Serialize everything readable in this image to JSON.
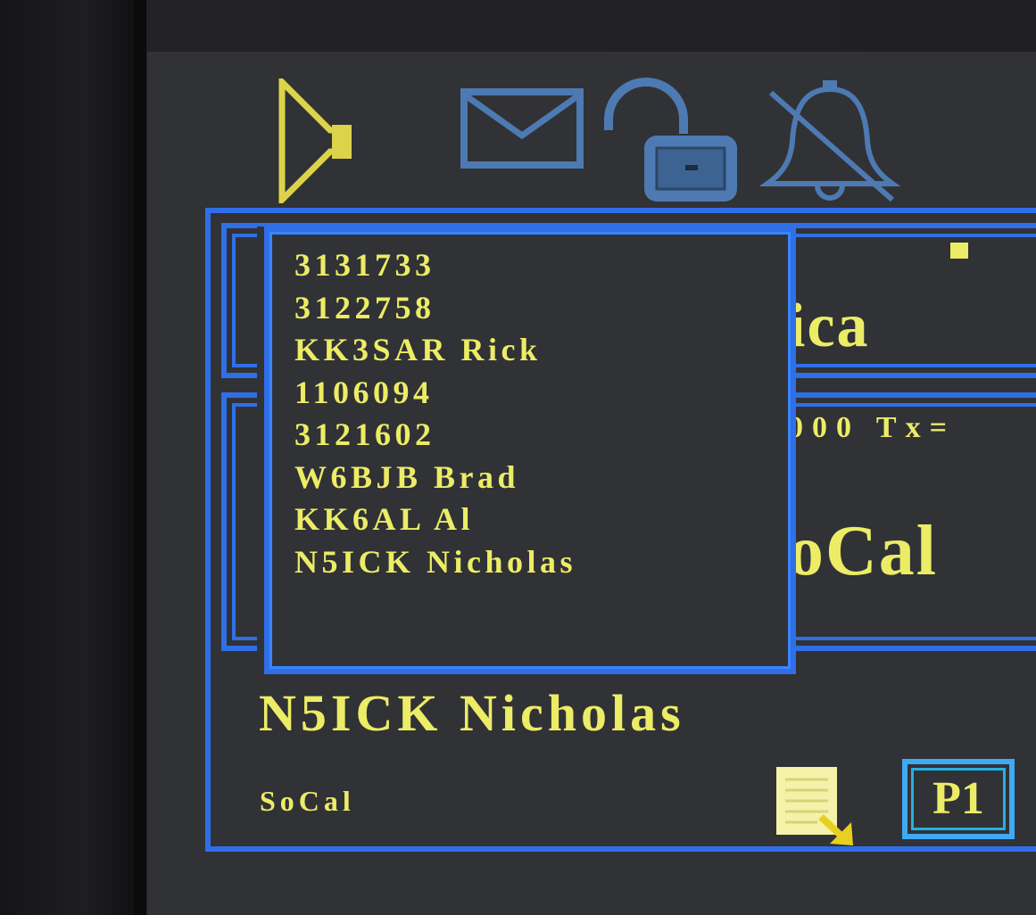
{
  "status_icons": [
    "speaker-icon",
    "mail-icon",
    "unlocked-icon",
    "bell-muted-icon"
  ],
  "background": {
    "zone_title_partial": "ica",
    "freq_partial": "000  Tx=",
    "talkgroup_partial": "oCal"
  },
  "contact_list": {
    "items": [
      "3131733",
      "3122758",
      "KK3SAR Rick",
      "1106094",
      "3121602",
      "W6BJB Brad",
      "KK6AL Al",
      "N5ICK Nicholas"
    ]
  },
  "caller": {
    "name": "N5ICK Nicholas"
  },
  "zone": {
    "label": "SoCal"
  },
  "footer": {
    "program_button_label": "P1",
    "notes_icon": "notes-arrow-icon"
  },
  "colors": {
    "text_yellow": "#ecec66",
    "frame_blue": "#2f6fe8",
    "button_cyan": "#3fa9f5",
    "icon_blue": "#4d7ab2",
    "screen_bg": "#313236"
  }
}
